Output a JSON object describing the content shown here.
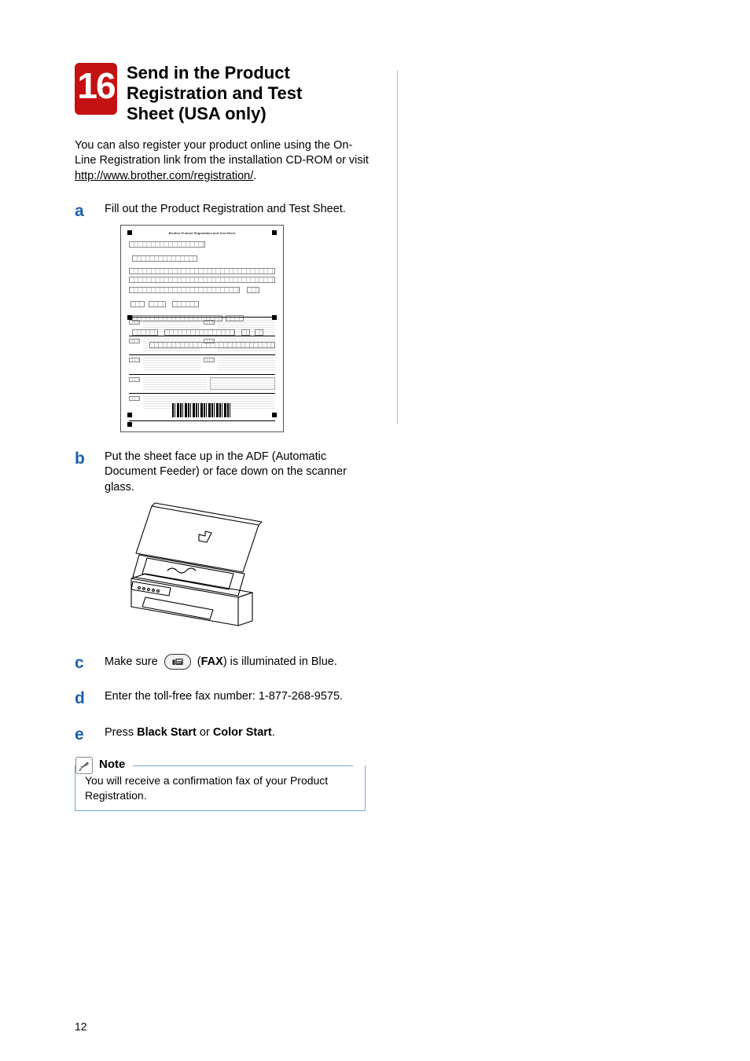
{
  "step": {
    "number": "16",
    "title_line1": "Send in the Product",
    "title_line2": "Registration and Test",
    "title_line3": "Sheet (USA only)"
  },
  "intro": {
    "line1": "You can also register your product online using the On-Line Registration link from the installation CD-ROM or visit",
    "url": "http://www.brother.com/registration/",
    "period": "."
  },
  "a": {
    "letter": "a",
    "text": "Fill out the Product Registration and Test Sheet."
  },
  "b": {
    "letter": "b",
    "text": "Put the sheet face up in the ADF (Automatic Document Feeder) or face down on the scanner glass."
  },
  "c": {
    "letter": "c",
    "pre": "Make sure",
    "post": "(",
    "fax_label": "FAX",
    "after": ") is illuminated in Blue."
  },
  "d": {
    "letter": "d",
    "text": "Enter the toll-free fax number: 1-877-268-9575."
  },
  "e": {
    "letter": "e",
    "pre": "Press ",
    "b1": "Black Start",
    "mid": " or ",
    "b2": "Color Start",
    "after": "."
  },
  "note": {
    "label": "Note",
    "text": "You will receive a confirmation fax of your Product Registration."
  },
  "pagenum": "12",
  "formsheet": {
    "title": "Brother Product Registration and Test Sheet"
  }
}
